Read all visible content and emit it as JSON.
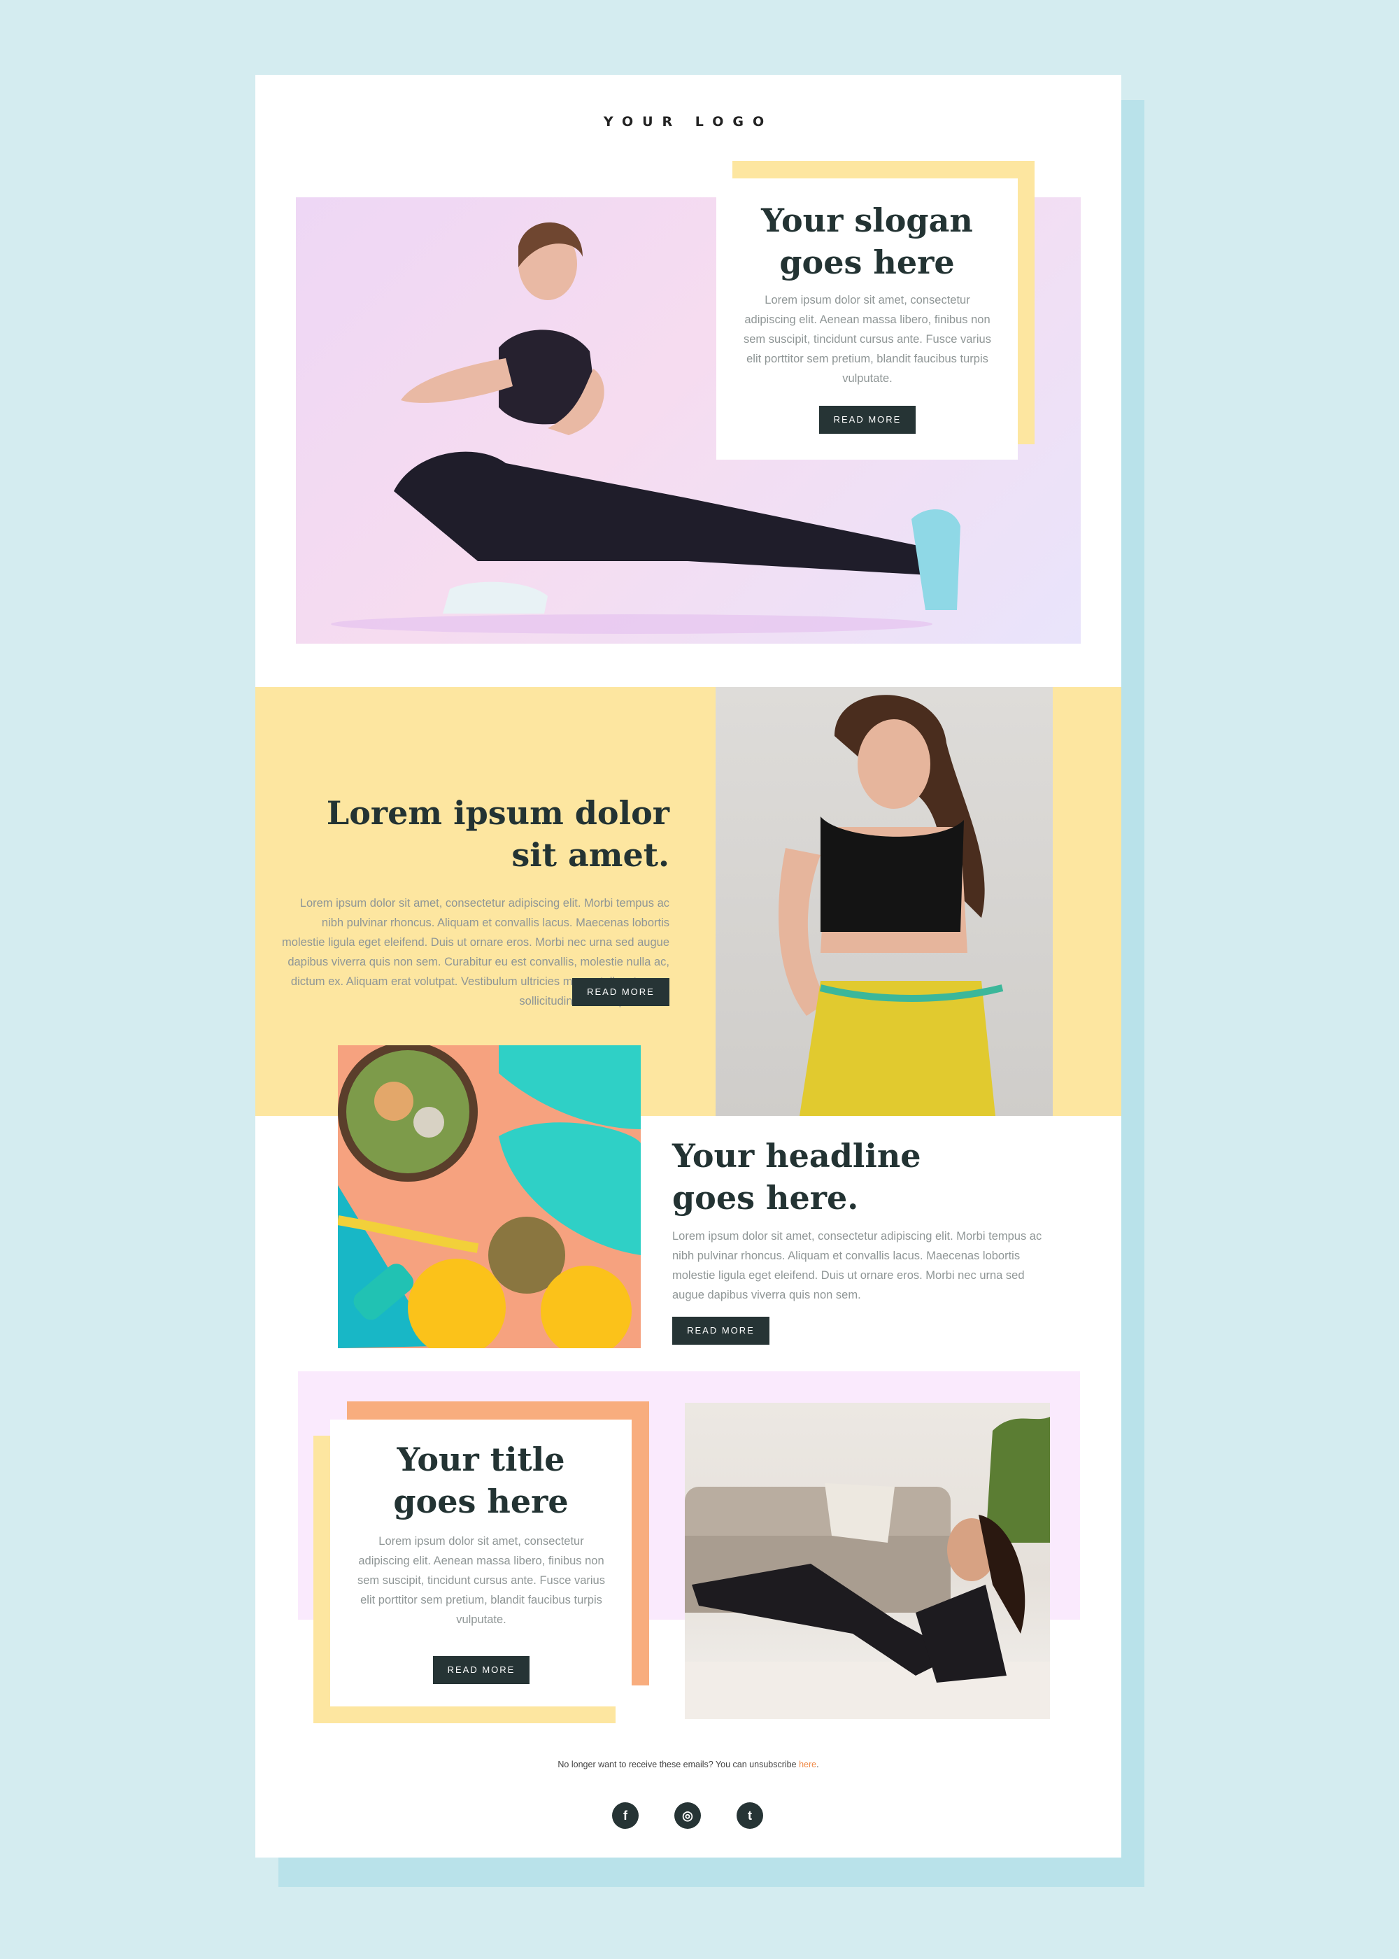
{
  "header": {
    "logo": "YOUR LOGO"
  },
  "hero": {
    "title_line1": "Your slogan",
    "title_line2": "goes here",
    "body": "Lorem ipsum dolor sit amet, consectetur adipiscing elit. Aenean massa libero, finibus non sem suscipit, tincidunt cursus ante. Fusce varius elit porttitor sem pretium, blandit faucibus turpis vulputate.",
    "button": "READ MORE"
  },
  "section2": {
    "title_line1": "Lorem ipsum dolor",
    "title_line2": "sit amet.",
    "body": "Lorem ipsum dolor sit amet, consectetur adipiscing elit. Morbi tempus ac nibh pulvinar rhoncus. Aliquam et convallis lacus. Maecenas lobortis molestie ligula eget eleifend. Duis ut ornare eros. Morbi nec urna sed augue dapibus viverra quis non sem. Curabitur eu est convallis, molestie nulla ac, dictum ex. Aliquam erat volutpat. Vestibulum ultricies massa tellus, tempor sollicitudin risus aliquam non.",
    "button": "READ MORE"
  },
  "section3": {
    "title_line1": "Your headline",
    "title_line2": "goes here.",
    "body": "Lorem ipsum dolor sit amet, consectetur adipiscing elit. Morbi tempus ac nibh pulvinar rhoncus. Aliquam et convallis lacus. Maecenas lobortis molestie ligula eget eleifend. Duis ut ornare eros. Morbi nec urna sed augue dapibus viverra quis non sem.",
    "button": "READ MORE"
  },
  "section4": {
    "title_line1": "Your title",
    "title_line2": "goes here",
    "body": "Lorem ipsum dolor sit amet, consectetur adipiscing elit. Aenean massa libero, finibus non sem suscipit, tincidunt cursus ante. Fusce varius elit porttitor sem pretium, blandit faucibus turpis vulputate.",
    "button": "READ MORE"
  },
  "footer": {
    "unsubscribe_text": "No longer want to receive these emails? You can unsubscribe ",
    "unsubscribe_link": "here",
    "unsubscribe_end": ".",
    "social": [
      {
        "icon": "facebook-icon",
        "glyph": "f"
      },
      {
        "icon": "instagram-icon",
        "glyph": "◎"
      },
      {
        "icon": "twitter-icon",
        "glyph": "t"
      }
    ]
  },
  "colors": {
    "background": "#d4ecf0",
    "yellow": "#fde6a0",
    "peach": "#f8ad7e",
    "lavender": "#faeafd",
    "button": "#263435",
    "link": "#f08a47"
  }
}
